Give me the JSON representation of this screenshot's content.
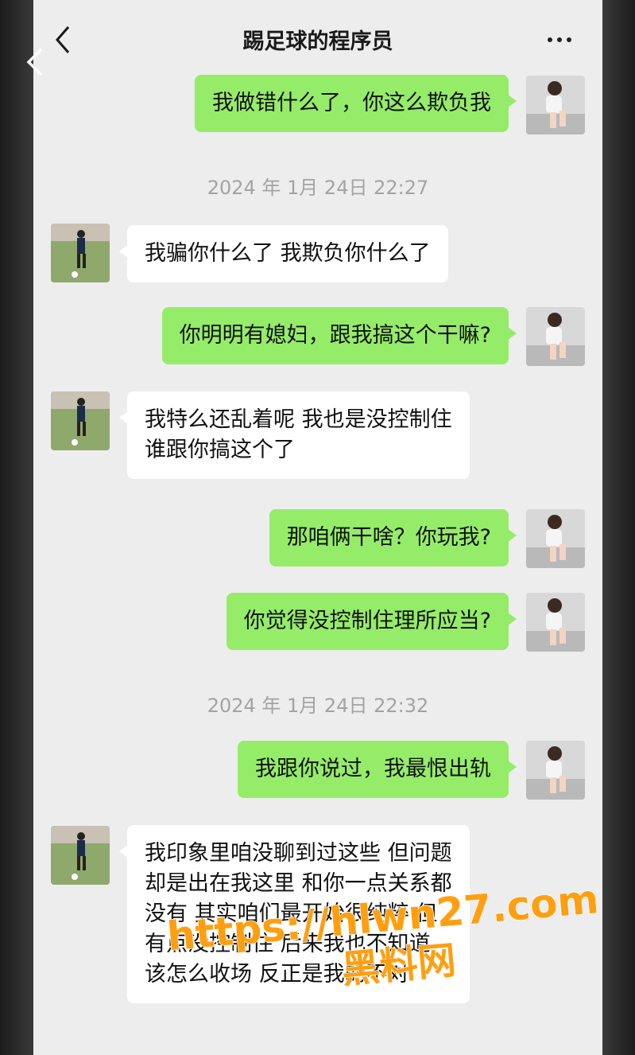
{
  "header": {
    "title": "踢足球的程序员"
  },
  "icons": {
    "back": "chevron-left-icon",
    "more": "more-dots-icon"
  },
  "colors": {
    "sent_bubble": "#95ec69",
    "received_bubble": "#ffffff",
    "background": "#ededed",
    "watermark": "#ff9f10"
  },
  "messages": [
    {
      "side": "right",
      "text": "我做错什么了，你这么欺负我"
    },
    {
      "timestamp": "2024 年 1月 24日 22:27"
    },
    {
      "side": "left",
      "text": "我骗你什么了 我欺负你什么了"
    },
    {
      "side": "right",
      "text": "你明明有媳妇，跟我搞这个干嘛?"
    },
    {
      "side": "left",
      "lines": [
        "我特么还乱着呢 我也是没控制住",
        "谁跟你搞这个了"
      ]
    },
    {
      "side": "right",
      "text": "那咱俩干啥？你玩我?"
    },
    {
      "side": "right",
      "text": "你觉得没控制住理所应当?"
    },
    {
      "timestamp": "2024 年 1月 24日 22:32"
    },
    {
      "side": "right",
      "text": "我跟你说过，我最恨出轨"
    },
    {
      "side": "left",
      "lines": [
        "我印象里咱没聊到过这些 但问题",
        "却是出在我这里 和你一点关系都",
        "没有 其实咱们最开始很纯粹 但",
        "有点没控制住 后来我也不知道",
        "该怎么收场 反正是我的不对"
      ]
    }
  ],
  "watermark": {
    "url": "https://hlwn27.com",
    "label": "黑料网"
  }
}
